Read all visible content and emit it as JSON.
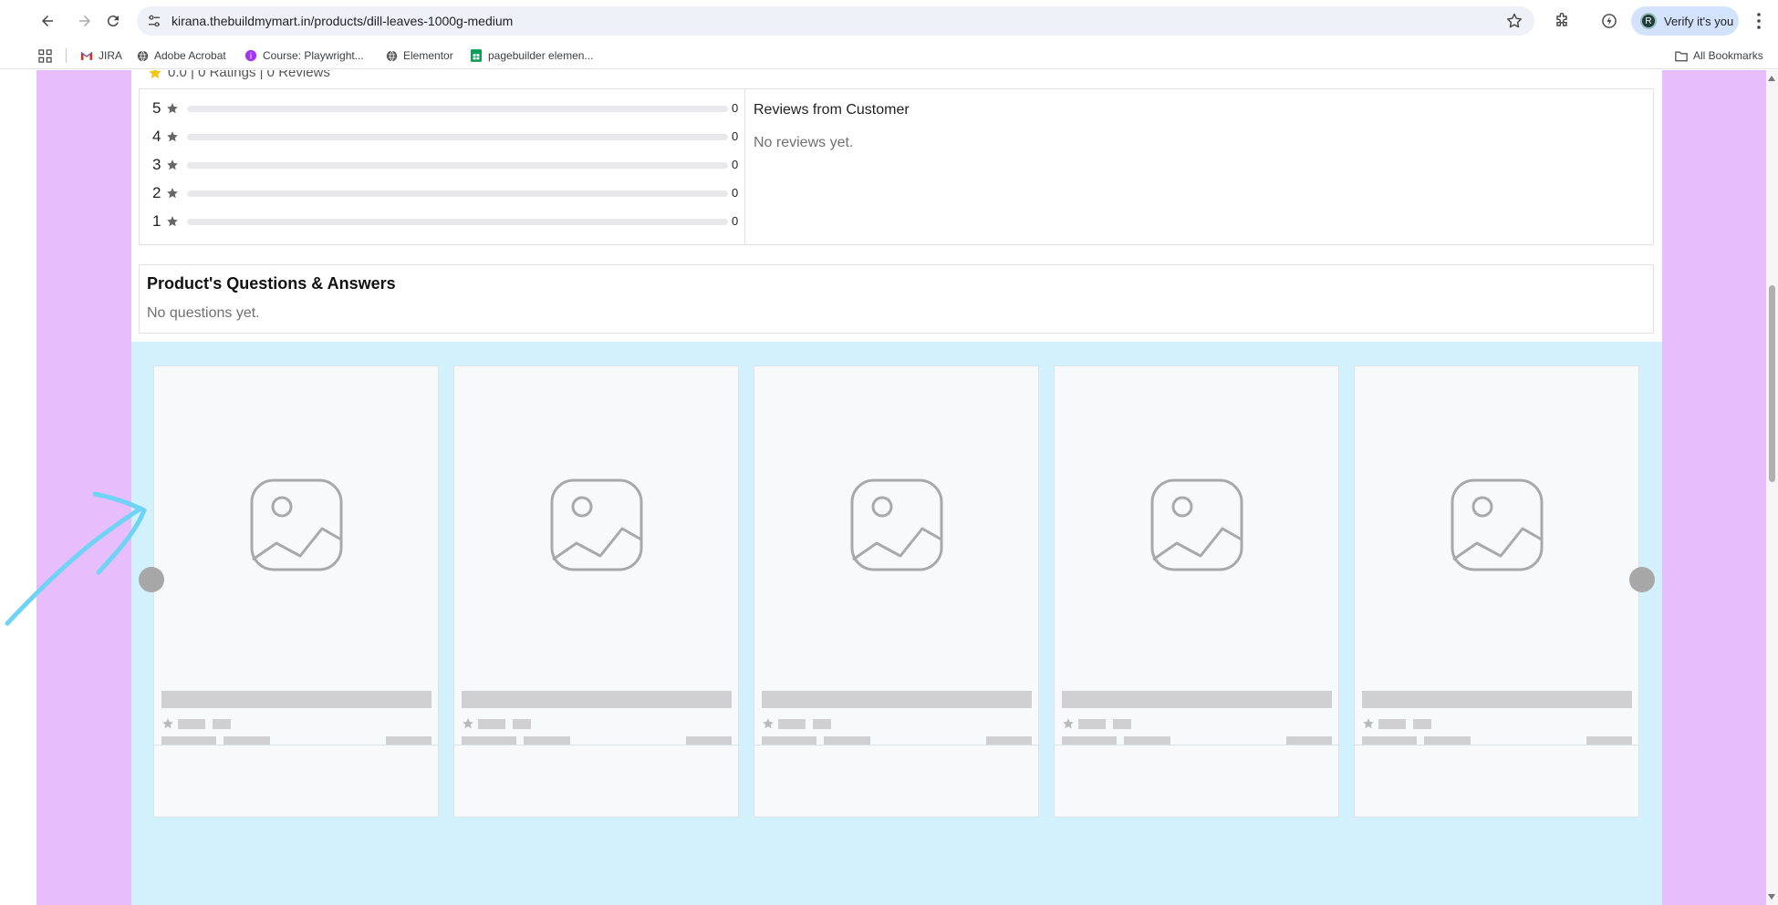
{
  "browser": {
    "url_host": "kirana.thebuildmymart.in",
    "url_path": "/products/dill-leaves-1000g-medium",
    "profile_initial": "R",
    "profile_label": "Verify it's you"
  },
  "bookmarks": {
    "items": [
      {
        "label": "JIRA",
        "icon": "gmail-icon"
      },
      {
        "label": "Adobe Acrobat",
        "icon": "globe-icon"
      },
      {
        "label": "Course: Playwright...",
        "icon": "course-icon"
      },
      {
        "label": "Elementor",
        "icon": "globe-icon"
      },
      {
        "label": "pagebuilder elemen...",
        "icon": "sheets-icon"
      }
    ],
    "all_label": "All Bookmarks"
  },
  "ratings": {
    "summary": "0.0 | 0 Ratings | 0 Reviews",
    "rows": [
      {
        "stars": "5",
        "count": "0",
        "fill": 0
      },
      {
        "stars": "4",
        "count": "0",
        "fill": 0
      },
      {
        "stars": "3",
        "count": "0",
        "fill": 0
      },
      {
        "stars": "2",
        "count": "0",
        "fill": 0
      },
      {
        "stars": "1",
        "count": "0",
        "fill": 0
      }
    ],
    "reviews_title": "Reviews from Customer",
    "reviews_empty": "No reviews yet."
  },
  "qa": {
    "title": "Product's Questions & Answers",
    "empty": "No questions yet."
  },
  "colors": {
    "page_bg": "#e8bdfb",
    "carousel_bg": "#d2f1fd",
    "skeleton": "#d0d0d3",
    "skeleton_button": "#ababab",
    "annotation": "#6fd3f5"
  }
}
